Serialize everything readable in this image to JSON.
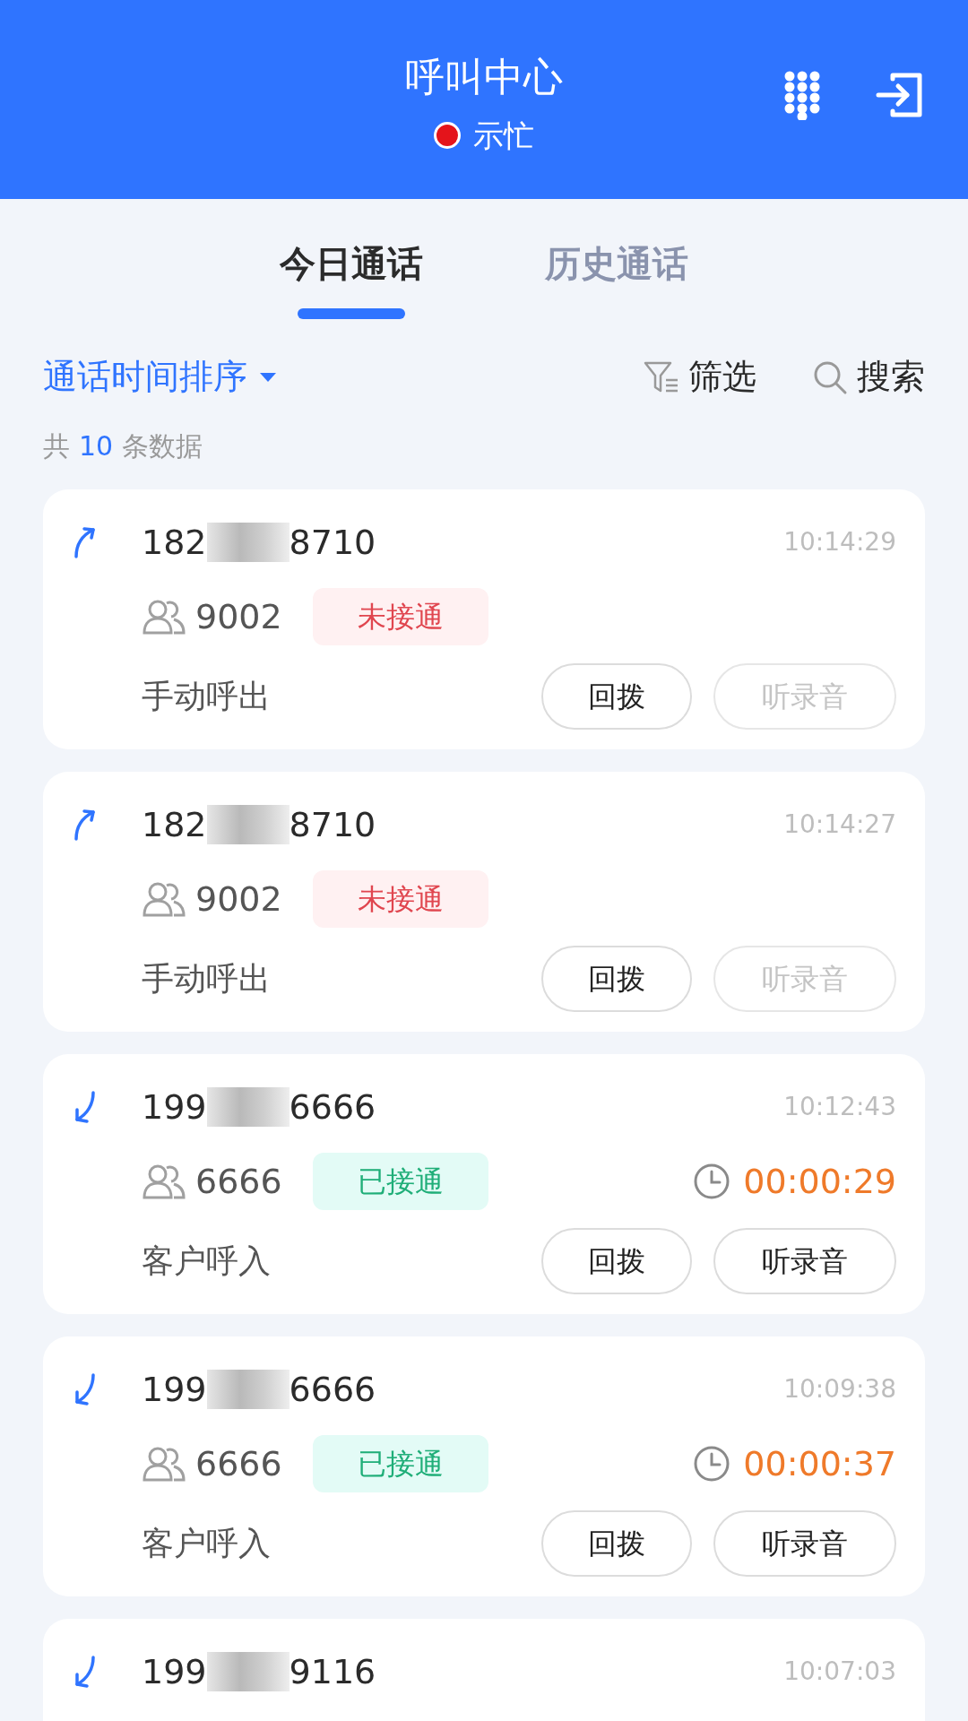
{
  "header": {
    "title": "呼叫中心",
    "status": {
      "kind": "busy",
      "label": "示忙"
    }
  },
  "tabs": [
    {
      "label": "今日通话",
      "selected": true
    },
    {
      "label": "历史通话",
      "selected": false
    }
  ],
  "toolbar": {
    "sort": "通话时间排序",
    "filter": "筛选",
    "search": "搜索"
  },
  "summary": {
    "prefix": "共",
    "count": "10",
    "suffix": "条数据"
  },
  "calls": [
    {
      "kind": "outgoing",
      "number_start": "182",
      "number_end": "8710",
      "time": "10:14:29",
      "agent": "9002",
      "status": {
        "kind": "missed",
        "label": "未接通"
      },
      "type": "手动呼出",
      "callback": "回拨",
      "recording": "听录音",
      "recording_available": false
    },
    {
      "kind": "outgoing",
      "number_start": "182",
      "number_end": "8710",
      "time": "10:14:27",
      "agent": "9002",
      "status": {
        "kind": "missed",
        "label": "未接通"
      },
      "type": "手动呼出",
      "callback": "回拨",
      "recording": "听录音",
      "recording_available": false
    },
    {
      "kind": "incoming",
      "number_start": "199",
      "number_end": "6666",
      "time": "10:12:43",
      "agent": "6666",
      "status": {
        "kind": "answered",
        "label": "已接通"
      },
      "duration": "00:00:29",
      "type": "客户呼入",
      "callback": "回拨",
      "recording": "听录音",
      "recording_available": true
    },
    {
      "kind": "incoming",
      "number_start": "199",
      "number_end": "6666",
      "time": "10:09:38",
      "agent": "6666",
      "status": {
        "kind": "answered",
        "label": "已接通"
      },
      "duration": "00:00:37",
      "type": "客户呼入",
      "callback": "回拨",
      "recording": "听录音",
      "recording_available": true
    },
    {
      "kind": "incoming",
      "number_start": "199",
      "number_end": "9116",
      "time": "10:07:03"
    }
  ]
}
